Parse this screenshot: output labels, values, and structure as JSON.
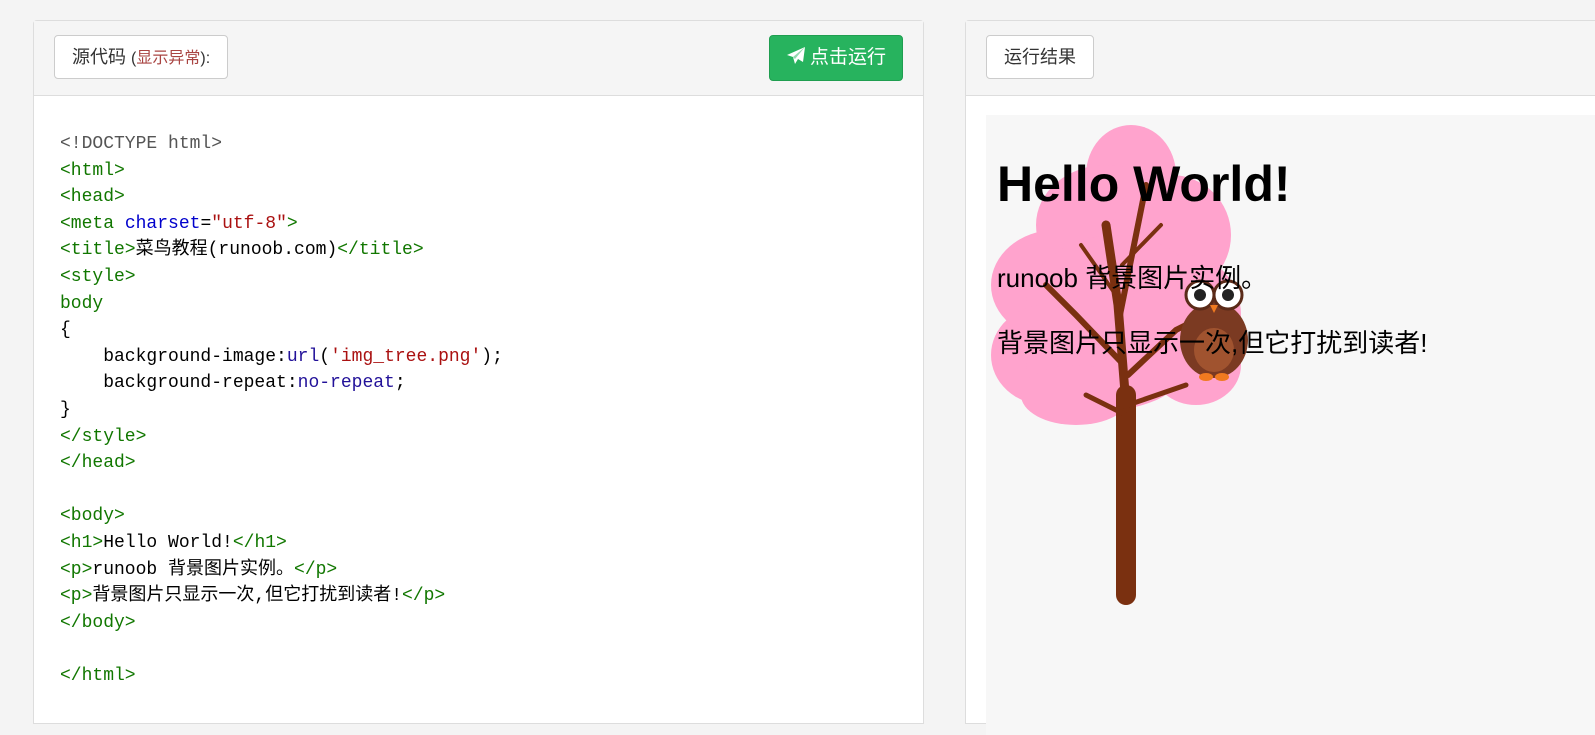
{
  "source_panel": {
    "tab_label": "源代码",
    "error_prefix": "(",
    "error_link": "显示异常",
    "error_suffix": "):",
    "run_button": "点击运行",
    "code_lines": [
      "<!DOCTYPE html>",
      "<html>",
      "<head>",
      "<meta charset=\"utf-8\">",
      "<title>菜鸟教程(runoob.com)</title>",
      "<style>",
      "body",
      "{",
      "    background-image:url('img_tree.png');",
      "    background-repeat:no-repeat;",
      "}",
      "</style>",
      "</head>",
      "",
      "<body>",
      "<h1>Hello World!</h1>",
      "<p>runoob 背景图片实例。</p>",
      "<p>背景图片只显示一次,但它打扰到读者!</p>",
      "</body>",
      "",
      "</html>"
    ]
  },
  "result_panel": {
    "tab_label": "运行结果",
    "heading": "Hello World!",
    "paragraph_1": "runoob 背景图片实例。",
    "paragraph_2": "背景图片只显示一次,但它打扰到读者!"
  },
  "colors": {
    "run_button": "#27b35e",
    "tag": "#117700",
    "string": "#aa1111",
    "attribute": "#0000cc",
    "keyword": "#221199",
    "tree_foliage": "#ffa3cd",
    "tree_trunk": "#7a3010"
  },
  "icons": {
    "run_button_icon": "paper-plane-icon"
  }
}
